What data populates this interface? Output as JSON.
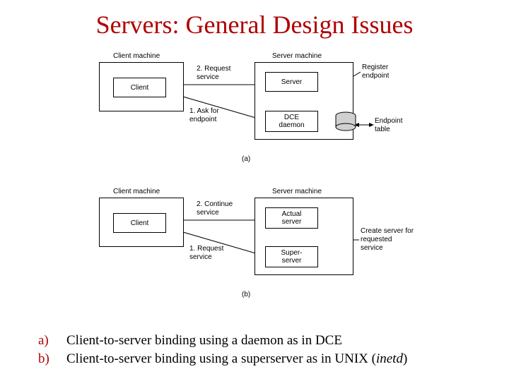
{
  "title": "Servers: General Design Issues",
  "diagram": {
    "a": {
      "client_machine": "Client machine",
      "server_machine": "Server machine",
      "client": "Client",
      "server": "Server",
      "dce_daemon": "DCE\ndaemon",
      "register_endpoint": "Register\nendpoint",
      "endpoint_table": "Endpoint\ntable",
      "req_service": "2. Request\nservice",
      "ask_endpoint": "1. Ask for\nendpoint",
      "label": "(a)"
    },
    "b": {
      "client_machine": "Client machine",
      "server_machine": "Server machine",
      "client": "Client",
      "actual_server": "Actual\nserver",
      "super_server": "Super-\nserver",
      "create_server": "Create server for\nrequested\nservice",
      "continue_service": "2. Continue\nservice",
      "req_service": "1. Request\nservice",
      "label": "(b)"
    }
  },
  "captions": {
    "a_letter": "a)",
    "a_text": "Client-to-server binding using a daemon as in DCE",
    "b_letter": "b)",
    "b_text": "Client-to-server binding using a superserver as in UNIX (inetd)"
  }
}
